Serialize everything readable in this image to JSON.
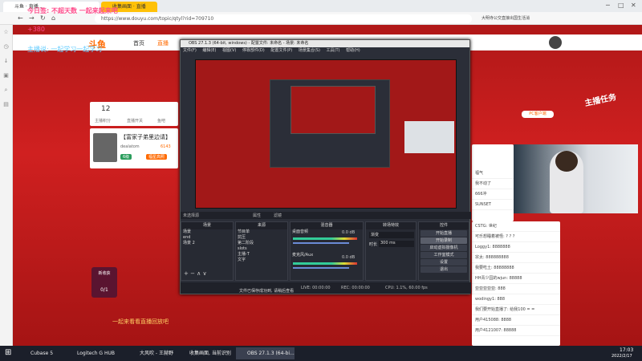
{
  "browser": {
    "tabs": [
      "斗鱼 · 直播...",
      "收集画面 · 直播"
    ],
    "url": "https://www.douyu.com/topic/qtyl?rid=709710",
    "right_text": "大明寺公交直接出国生活消"
  },
  "overlay": {
    "line1": "今日签: 不超天数 一起来起来吧",
    "line2": "+380",
    "line3": "主播说: 一起学习一起学习"
  },
  "site": {
    "logo": "斗鱼",
    "nav": [
      "首页",
      "直播"
    ],
    "stats": [
      {
        "value": "12",
        "label": "主播积分"
      },
      {
        "value": "",
        "label": "直播开关"
      },
      {
        "value": "",
        "label": "鱼吧"
      }
    ],
    "room_title": "【富家子弟里边请】",
    "room_user": "dealatom",
    "room_num": "6143",
    "room_badge": "6级",
    "room_follow": "福星高照",
    "pc_btn": "PC客户端",
    "promo_text": "主播任务",
    "gift_count": "0/1",
    "bottom_caption": "一起来看看直播回放吧",
    "event_label": "新收获"
  },
  "obs": {
    "title": "OBS 27.1.3 (64-bit, windows) - 配置文件: 未命名 - 场景: 未命名",
    "menu": [
      "文件(F)",
      "编辑(E)",
      "视图(V)",
      "停靠部件(D)",
      "配置文件(P)",
      "场景集合(S)",
      "工具(T)",
      "帮助(H)"
    ],
    "no_source": "未选择源",
    "btn_props": "属性",
    "btn_filters": "滤镜",
    "docks": {
      "scenes": "场景",
      "sources": "来源",
      "mixer": "混音器",
      "transitions": "转场特效",
      "controls": "控件"
    },
    "scenes": [
      "场景",
      "end",
      "场景 2"
    ],
    "sources": [
      "节目单",
      "抗压",
      "第二阶段",
      "slots",
      "主播-T",
      "文字"
    ],
    "mixer_tracks": [
      {
        "name": "桌面音频",
        "db": "0.0 dB"
      },
      {
        "name": "麦克风/Aux",
        "db": "0.0 dB"
      }
    ],
    "transition_type": "渐变",
    "duration_label": "时长",
    "duration": "300 ms",
    "controls": [
      "开始直播",
      "开始录制",
      "启动虚拟摄像机",
      "工作室模式",
      "设置",
      "退出"
    ],
    "status": {
      "live": "LIVE: 00:00:00",
      "rec": "REC: 00:00:00",
      "cpu": "CPU: 1.1%, 60.00 fps"
    },
    "dialog_footer": "文件已保存成功到, 请稍后查看"
  },
  "chat": {
    "rows": [
      {
        "user": "",
        "text": "CSTG: 世纪"
      },
      {
        "user": "",
        "text": "可乐想睡着被怪: ? ? ?"
      },
      {
        "user": "",
        "text": "Loggy1: 8888888"
      },
      {
        "user": "",
        "text": "宗太: 888888888"
      },
      {
        "user": "",
        "text": "我要吃土: 88888888"
      },
      {
        "user": "",
        "text": "HH青少园的wjun: 88888"
      },
      {
        "user": "",
        "text": "亚亚亚亚亚: 888"
      },
      {
        "user": "",
        "text": "wodingy1: 888"
      },
      {
        "user": "",
        "text": "我们要开始直播了: 给我100 = ="
      },
      {
        "user": "",
        "text": "用户415088: 8888"
      },
      {
        "user": "",
        "text": "用户4121007: 88888"
      }
    ],
    "gifts": [
      "福气",
      "我不动了",
      "666冲",
      "SUNSET"
    ]
  },
  "taskbar": {
    "items": [
      "Cubase 5",
      "Logitech G HUB",
      "大风吹 - 王赫野",
      "收集画面, 当前识别",
      "OBS 27.1.3 (64-bi..."
    ],
    "time": "17:03",
    "date": "2022/2/17"
  },
  "colors": {
    "accent": "#ff6a00",
    "douyu_red": "#d02020"
  }
}
